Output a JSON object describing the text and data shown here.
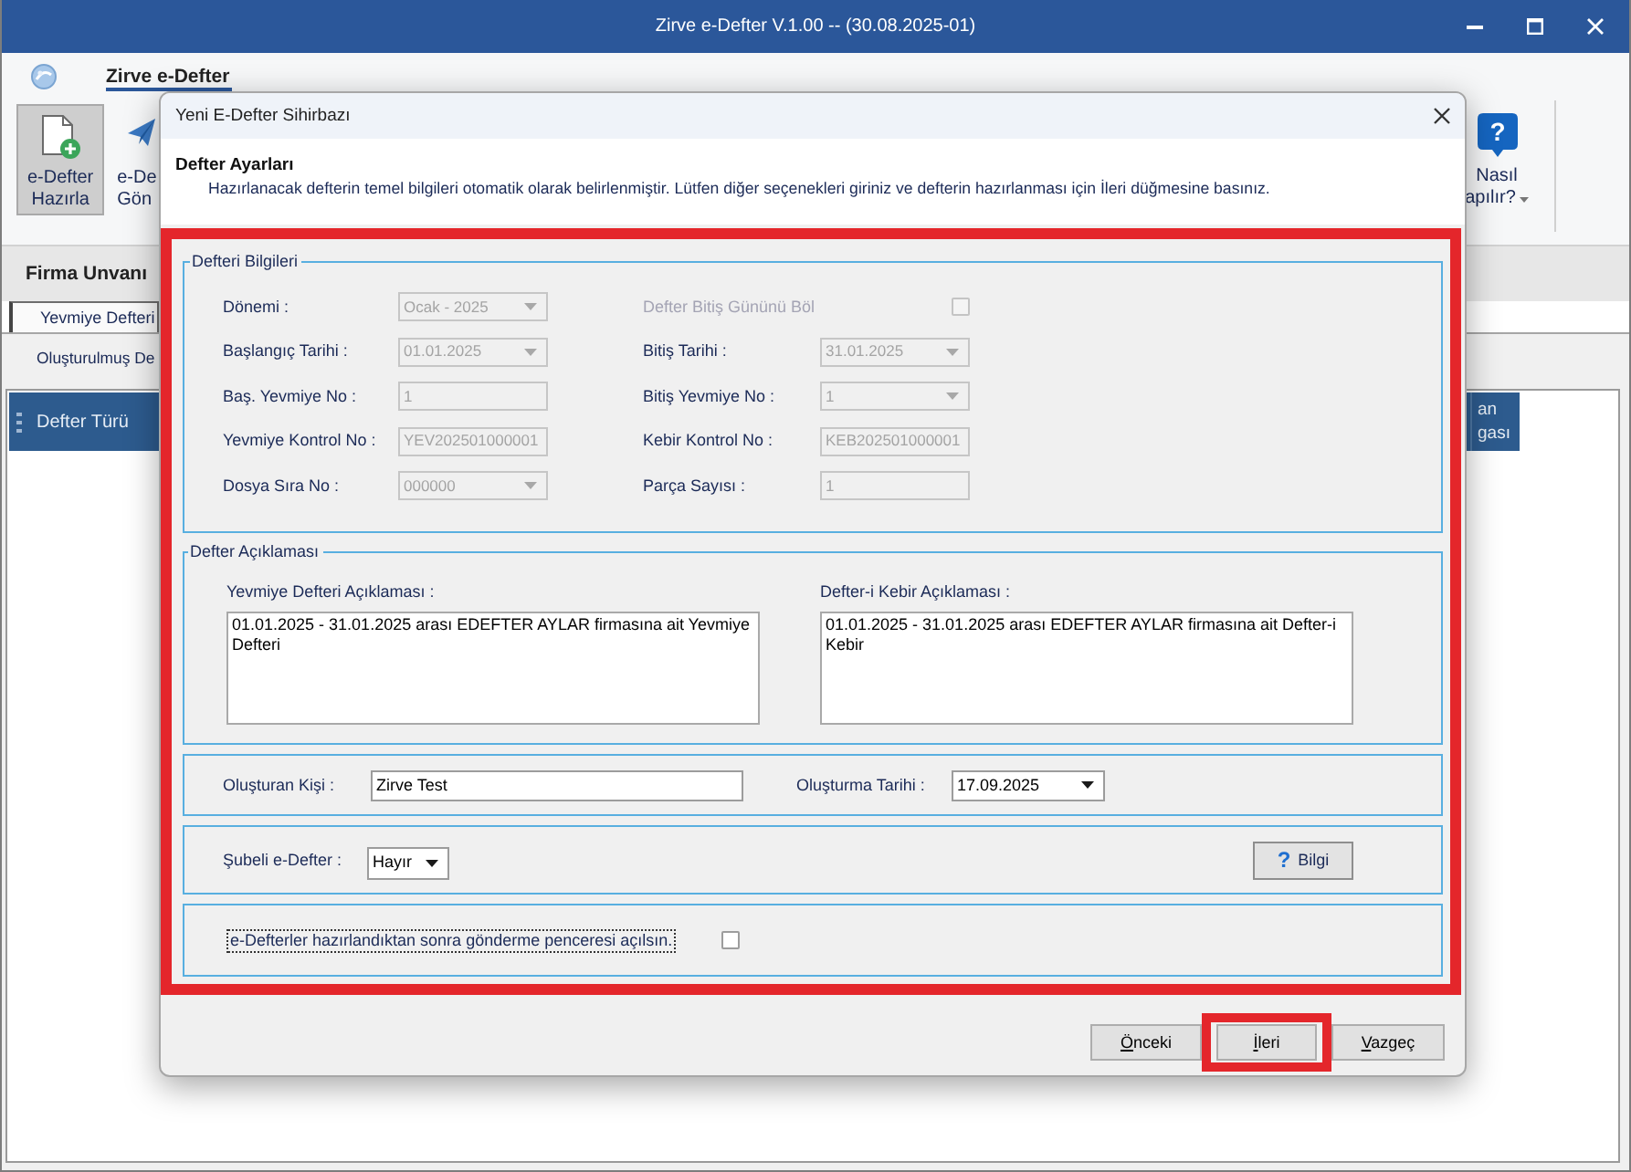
{
  "app": {
    "title": "Zirve e-Defter V.1.00 -- (30.08.2025-01)",
    "ribbon_tab": "Zirve e-Defter",
    "ribbon_buttons": [
      {
        "kind": "new_document",
        "lines": [
          "e-Defter",
          "Hazırla"
        ],
        "selected": true
      },
      {
        "kind": "send",
        "lines": [
          "e-De",
          "Gön"
        ],
        "selected": false
      }
    ],
    "help_button": {
      "glyph": "?",
      "lines": [
        "Nasıl",
        "apılır?"
      ]
    },
    "company_label": "Firma Unvanı",
    "tabs": [
      {
        "label": "Yevmiye Defteri",
        "selected": true
      }
    ],
    "list_label": "Oluşturulmuş De",
    "grid_columns": [
      {
        "lines": [
          "Defter Türü"
        ]
      },
      {
        "lines": [
          "an",
          "gası"
        ]
      }
    ]
  },
  "dialog": {
    "title": "Yeni E-Defter Sihirbazı",
    "heading": "Defter Ayarları",
    "description": "Hazırlanacak defterin temel bilgileri otomatik olarak belirlenmiştir. Lütfen diğer seçenekleri giriniz ve defterin hazırlanması için İleri düğmesine basınız.",
    "highlighted": true,
    "info_group": {
      "legend": "Defteri Bilgileri",
      "rows": [
        {
          "left": {
            "kind": "select",
            "label": "Dönemi :",
            "value": "Ocak - 2025",
            "disabled": true
          },
          "right": {
            "kind": "checkbox",
            "label": "Defter Bitiş Gününü Böl",
            "checked": false,
            "disabled": true
          }
        },
        {
          "left": {
            "kind": "select",
            "label": "Başlangıç Tarihi :",
            "value": "01.01.2025",
            "disabled": true
          },
          "right": {
            "kind": "select",
            "label": "Bitiş Tarihi :",
            "value": "31.01.2025",
            "disabled": true
          }
        },
        {
          "left": {
            "kind": "text",
            "label": "Baş. Yevmiye No :",
            "value": "1",
            "disabled": true
          },
          "right": {
            "kind": "select",
            "label": "Bitiş Yevmiye No :",
            "value": "1",
            "disabled": true
          }
        },
        {
          "left": {
            "kind": "text",
            "label": "Yevmiye Kontrol No :",
            "value": "YEV202501000001",
            "disabled": true
          },
          "right": {
            "kind": "text",
            "label": "Kebir Kontrol No :",
            "value": "KEB202501000001",
            "disabled": true
          }
        },
        {
          "left": {
            "kind": "select",
            "label": "Dosya Sıra No :",
            "value": "000000",
            "disabled": true
          },
          "right": {
            "kind": "text",
            "label": "Parça Sayısı :",
            "value": "1",
            "disabled": true
          }
        }
      ]
    },
    "description_group": {
      "legend": "Defter Açıklaması",
      "fields": [
        {
          "label": "Yevmiye Defteri Açıklaması :",
          "value": "01.01.2025 - 31.01.2025 arası EDEFTER AYLAR firmasına ait Yevmiye Defteri"
        },
        {
          "label": "Defter-i Kebir Açıklaması :",
          "value": "01.01.2025 - 31.01.2025 arası EDEFTER AYLAR firmasına ait Defter-i Kebir"
        }
      ]
    },
    "creator_group": {
      "fields": [
        {
          "kind": "text",
          "label": "Oluşturan Kişi :",
          "value": "Zirve Test"
        },
        {
          "kind": "select",
          "label": "Oluşturma Tarihi :",
          "value": "17.09.2025"
        }
      ]
    },
    "branch_group": {
      "label": "Şubeli e-Defter :",
      "value": "Hayır",
      "info_button": {
        "glyph": "?",
        "label": "Bilgi"
      }
    },
    "send_option": {
      "label": "e-Defterler hazırlandıktan sonra gönderme penceresi açılsın.",
      "checked": false,
      "focused": true
    },
    "buttons": [
      {
        "label": "Önceki",
        "mnemonic": true,
        "highlighted": false
      },
      {
        "label": "İleri",
        "mnemonic": true,
        "highlighted": true
      },
      {
        "label": "Vazgeç",
        "mnemonic": true,
        "highlighted": false
      }
    ]
  }
}
